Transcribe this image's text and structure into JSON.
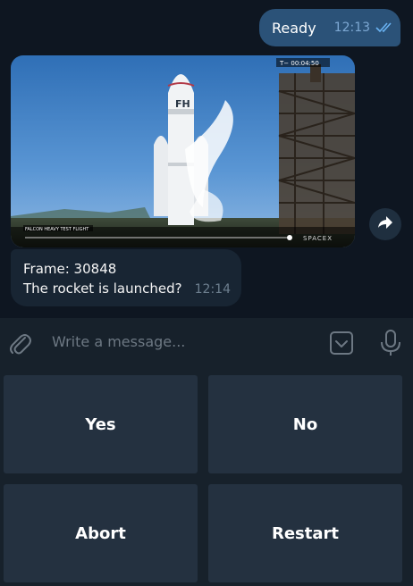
{
  "messages": {
    "outgoing": {
      "text": "Ready",
      "time": "12:13",
      "status_icon": "double-check-icon"
    },
    "media": {
      "overlay_timer": "T−  00:04:50",
      "caption": "FALCON HEAVY TEST FLIGHT",
      "watermark": "SPACEX",
      "rocket_logo": "FH"
    },
    "incoming": {
      "line1": "Frame: 30848",
      "line2": "The rocket is launched?",
      "time": "12:14"
    }
  },
  "composer": {
    "placeholder": "Write a message..."
  },
  "keyboard": {
    "buttons": [
      "Yes",
      "No",
      "Abort",
      "Restart"
    ]
  },
  "colors": {
    "background": "#0e1621",
    "outgoing_bubble": "#2b5278",
    "incoming_bubble": "#182533",
    "panel": "#17212b",
    "button": "#243140",
    "tick": "#6ab3f3"
  }
}
